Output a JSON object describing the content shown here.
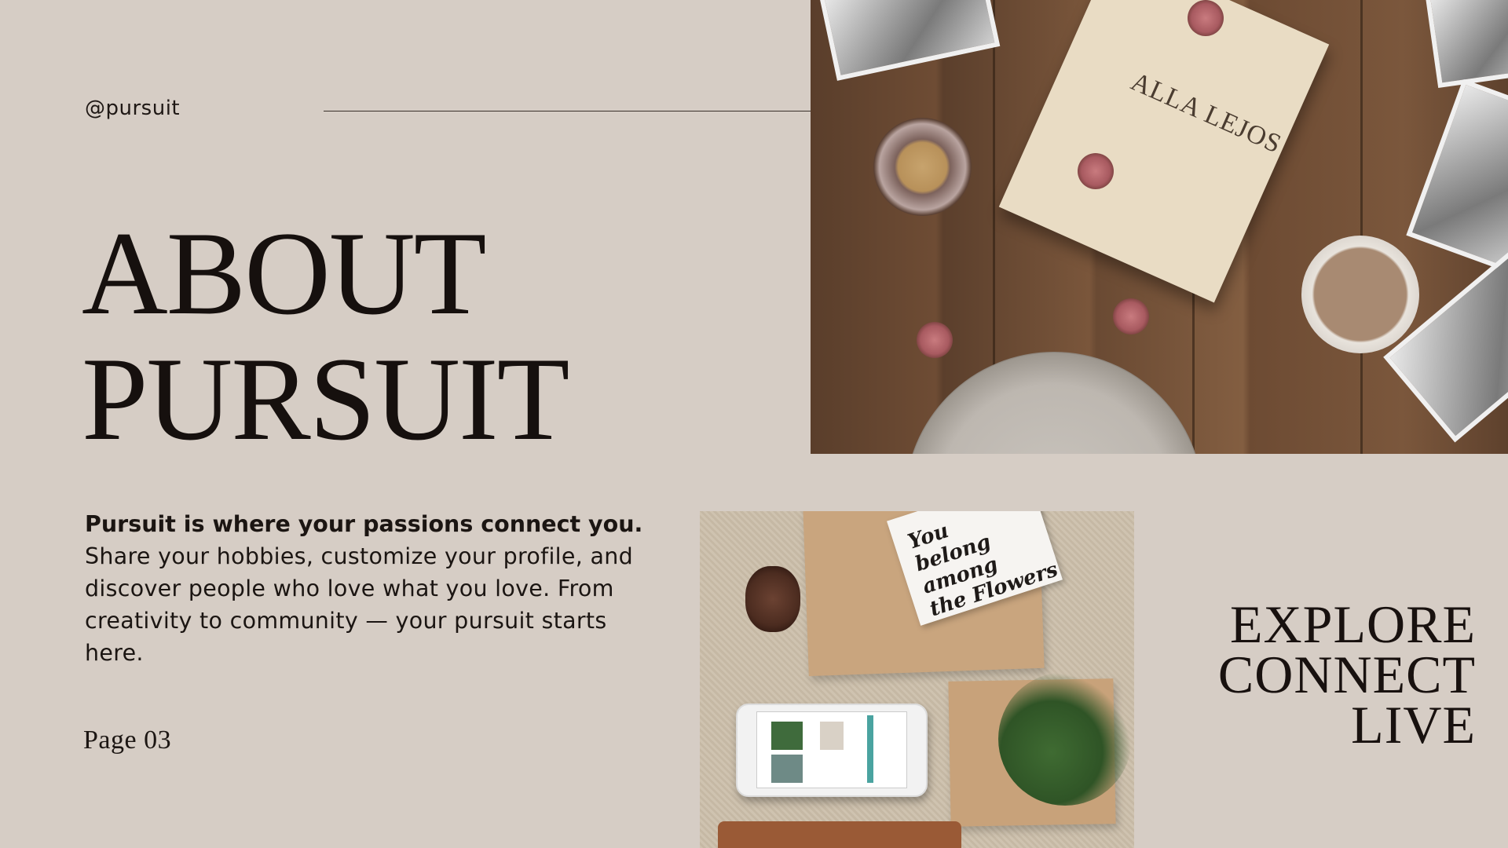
{
  "header": {
    "handle": "@pursuit"
  },
  "title": {
    "line1": "ABOUT",
    "line2": "PURSUIT"
  },
  "description": {
    "lead": "Pursuit is where your passions connect you.",
    "body": "Share your hobbies, customize your profile, and discover people who love what you love. From creativity to community — your pursuit starts here."
  },
  "footer": {
    "page_label": "Page 03"
  },
  "tagline": {
    "line1": "EXPLORE",
    "line2": "CONNECT",
    "line3": "LIVE"
  },
  "images": {
    "photo_top": {
      "book_title": "ALLA LEJOS"
    },
    "photo_bottom": {
      "card_text_1": "You",
      "card_text_2": "belong among",
      "card_text_3": "the Flowers"
    }
  },
  "colors": {
    "background": "#d6cdc5",
    "text": "#1a1412",
    "rule": "#3a302b"
  }
}
